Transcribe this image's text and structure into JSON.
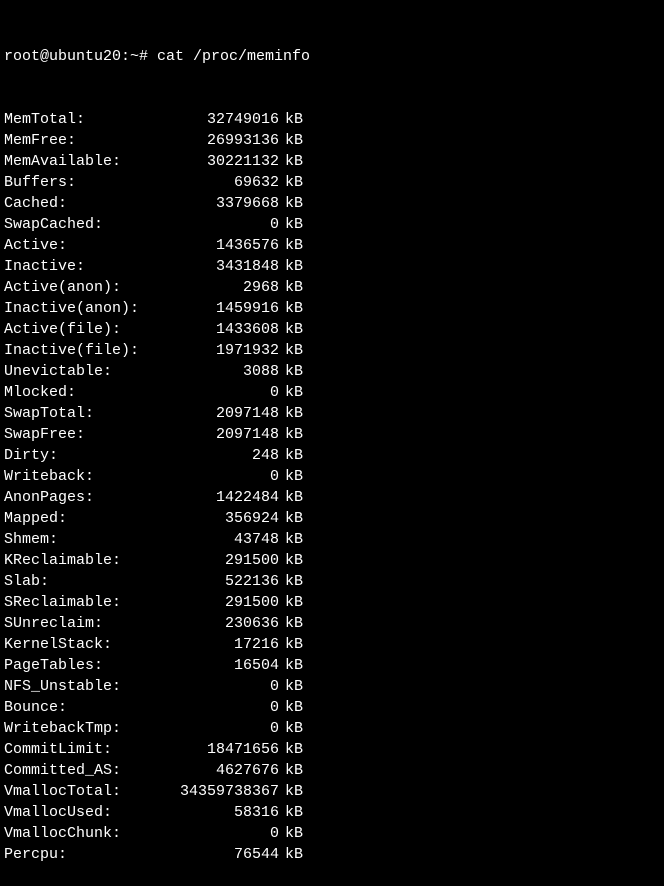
{
  "prompt": "root@ubuntu20:~# ",
  "command": "cat /proc/meminfo",
  "rows": [
    {
      "label": "MemTotal:",
      "value": "32749016",
      "unit": "kB"
    },
    {
      "label": "MemFree:",
      "value": "26993136",
      "unit": "kB"
    },
    {
      "label": "MemAvailable:",
      "value": "30221132",
      "unit": "kB"
    },
    {
      "label": "Buffers:",
      "value": "69632",
      "unit": "kB"
    },
    {
      "label": "Cached:",
      "value": "3379668",
      "unit": "kB"
    },
    {
      "label": "SwapCached:",
      "value": "0",
      "unit": "kB"
    },
    {
      "label": "Active:",
      "value": "1436576",
      "unit": "kB"
    },
    {
      "label": "Inactive:",
      "value": "3431848",
      "unit": "kB"
    },
    {
      "label": "Active(anon):",
      "value": "2968",
      "unit": "kB"
    },
    {
      "label": "Inactive(anon):",
      "value": "1459916",
      "unit": "kB"
    },
    {
      "label": "Active(file):",
      "value": "1433608",
      "unit": "kB"
    },
    {
      "label": "Inactive(file):",
      "value": "1971932",
      "unit": "kB"
    },
    {
      "label": "Unevictable:",
      "value": "3088",
      "unit": "kB"
    },
    {
      "label": "Mlocked:",
      "value": "0",
      "unit": "kB"
    },
    {
      "label": "SwapTotal:",
      "value": "2097148",
      "unit": "kB"
    },
    {
      "label": "SwapFree:",
      "value": "2097148",
      "unit": "kB"
    },
    {
      "label": "Dirty:",
      "value": "248",
      "unit": "kB"
    },
    {
      "label": "Writeback:",
      "value": "0",
      "unit": "kB"
    },
    {
      "label": "AnonPages:",
      "value": "1422484",
      "unit": "kB"
    },
    {
      "label": "Mapped:",
      "value": "356924",
      "unit": "kB"
    },
    {
      "label": "Shmem:",
      "value": "43748",
      "unit": "kB"
    },
    {
      "label": "KReclaimable:",
      "value": "291500",
      "unit": "kB"
    },
    {
      "label": "Slab:",
      "value": "522136",
      "unit": "kB"
    },
    {
      "label": "SReclaimable:",
      "value": "291500",
      "unit": "kB"
    },
    {
      "label": "SUnreclaim:",
      "value": "230636",
      "unit": "kB"
    },
    {
      "label": "KernelStack:",
      "value": "17216",
      "unit": "kB"
    },
    {
      "label": "PageTables:",
      "value": "16504",
      "unit": "kB"
    },
    {
      "label": "NFS_Unstable:",
      "value": "0",
      "unit": "kB"
    },
    {
      "label": "Bounce:",
      "value": "0",
      "unit": "kB"
    },
    {
      "label": "WritebackTmp:",
      "value": "0",
      "unit": "kB"
    },
    {
      "label": "CommitLimit:",
      "value": "18471656",
      "unit": "kB"
    },
    {
      "label": "Committed_AS:",
      "value": "4627676",
      "unit": "kB"
    },
    {
      "label": "VmallocTotal:",
      "value": "34359738367",
      "unit": "kB"
    },
    {
      "label": "VmallocUsed:",
      "value": "58316",
      "unit": "kB"
    },
    {
      "label": "VmallocChunk:",
      "value": "0",
      "unit": "kB"
    },
    {
      "label": "Percpu:",
      "value": "76544",
      "unit": "kB"
    }
  ]
}
